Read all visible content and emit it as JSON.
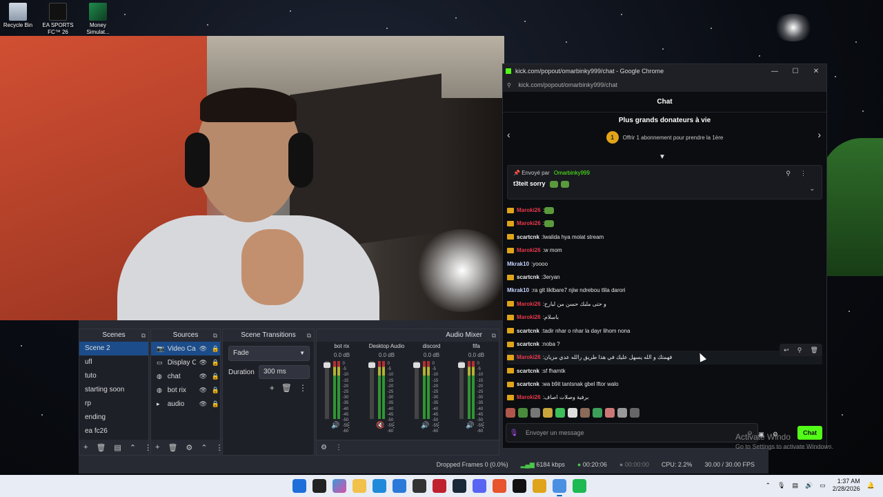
{
  "desktop": {
    "icons": [
      {
        "label": "Recycle Bin"
      },
      {
        "label": "EA SPORTS FC™ 26"
      },
      {
        "label": "Money Simulat..."
      }
    ],
    "watermark": {
      "line1": "Activate Windo",
      "line2": "Go to Settings to activate Windows."
    }
  },
  "obs": {
    "scenes": {
      "title": "Scenes",
      "items": [
        "Scene 2",
        "ufl",
        "tuto",
        "starting soon",
        "rp",
        "ending",
        "ea fc26"
      ],
      "selected": "Scene 2"
    },
    "sources": {
      "title": "Sources",
      "items": [
        {
          "name": "Video Cap",
          "icon": "camera-icon"
        },
        {
          "name": "Display Ca",
          "icon": "monitor-icon"
        },
        {
          "name": "chat",
          "icon": "browser-icon"
        },
        {
          "name": "bot rix",
          "icon": "browser-icon"
        },
        {
          "name": "audio",
          "icon": "folder-icon"
        }
      ]
    },
    "transitions": {
      "title": "Scene Transitions",
      "selected": "Fade",
      "duration_label": "Duration",
      "duration_value": "300 ms"
    },
    "mixer": {
      "title": "Audio Mixer",
      "channels": [
        {
          "name": "bot rix",
          "db": "0.0 dB",
          "muted": false
        },
        {
          "name": "Desktop Audio",
          "db": "0.0 dB",
          "muted": true
        },
        {
          "name": "discord",
          "db": "0.0 dB",
          "muted": false
        },
        {
          "name": "fifa",
          "db": "0.0 dB",
          "muted": false
        }
      ],
      "scale": [
        "0",
        "-5",
        "-10",
        "-15",
        "-20",
        "-25",
        "-30",
        "-35",
        "-40",
        "-45",
        "-50",
        "-55",
        "-60"
      ]
    },
    "status": {
      "dropped": "Dropped Frames 0 (0.0%)",
      "bitrate": "6184 kbps",
      "stream_time": "00:20:06",
      "rec_time": "00:00:00",
      "cpu": "CPU: 2.2%",
      "fps": "30.00 / 30.00 FPS"
    }
  },
  "chrome": {
    "title": "kick.com/popout/omarbinky999/chat - Google Chrome",
    "url": "kick.com/popout/omarbinky999/chat",
    "accent": "#53fc18"
  },
  "chat": {
    "header": "Chat",
    "donors_title": "Plus grands donateurs à vie",
    "donors_rank": "1",
    "donors_text": "Offrir 1 abonnement pour prendre la 1ère",
    "pinned": {
      "sent_by": "Envoyé par",
      "user": "Omarbinky999",
      "message": "t3teit sorry"
    },
    "messages": [
      {
        "user": "Maroki26",
        "color": "red",
        "badge": true,
        "text": "",
        "emote": true
      },
      {
        "user": "Maroki26",
        "color": "red",
        "badge": true,
        "text": "",
        "emote": true
      },
      {
        "user": "scartcnk",
        "color": "white",
        "badge": true,
        "text": "lwalida hya molat stream"
      },
      {
        "user": "Maroki26",
        "color": "red",
        "badge": true,
        "text": "w mom"
      },
      {
        "user": "Mkrak10",
        "color": "blue",
        "badge": false,
        "text": "yoooo"
      },
      {
        "user": "scartcnk",
        "color": "white",
        "badge": true,
        "text": "3eryan"
      },
      {
        "user": "Mkrak10",
        "color": "blue",
        "badge": false,
        "text": "ra glt liklbare7 njiw ndrebou tlila darori"
      },
      {
        "user": "Maroki26",
        "color": "red",
        "badge": true,
        "text": "و حتى ملبك حسن من لبارح"
      },
      {
        "user": "Maroki26",
        "color": "red",
        "badge": true,
        "text": "باسلام"
      },
      {
        "user": "scartcnk",
        "color": "white",
        "badge": true,
        "text": "tadir nhar o nhar la dayr lihom nona"
      },
      {
        "user": "scartcnk",
        "color": "white",
        "badge": true,
        "text": "noba ?"
      },
      {
        "user": "Maroki26",
        "color": "red",
        "badge": true,
        "text": "فهمتك و الله يسهل عليك في هذا طريق رالله عدي مزيان",
        "highlight": true
      },
      {
        "user": "scartcnk",
        "color": "white",
        "badge": true,
        "text": "sf fhamtk"
      },
      {
        "user": "scartcnk",
        "color": "white",
        "badge": true,
        "text": "wa b9it tantsnak gbel lftor walo"
      },
      {
        "user": "Maroki26",
        "color": "red",
        "badge": true,
        "text": "برفية وصلات اصاف"
      }
    ],
    "input_placeholder": "Envoyer un message",
    "send_label": "Chat"
  },
  "taskbar": {
    "time": "1:37 AM",
    "date": "2/28/2026"
  }
}
